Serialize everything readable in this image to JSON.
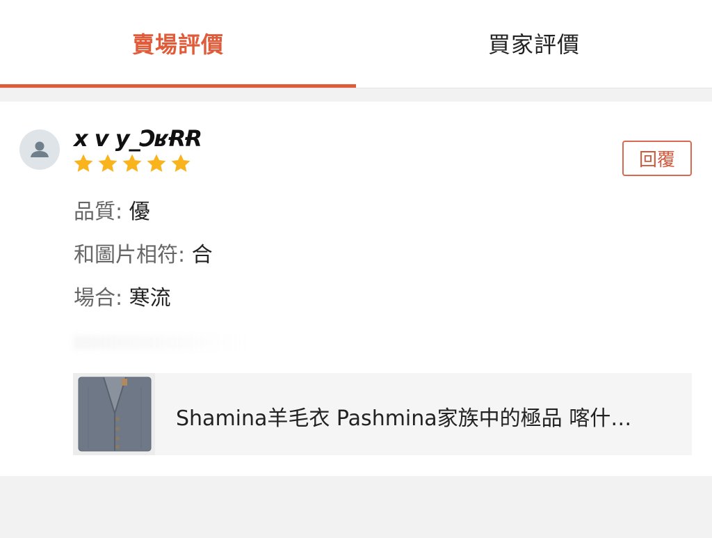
{
  "tabs": [
    {
      "label": "賣場評價",
      "active": true
    },
    {
      "label": "買家評價",
      "active": false
    }
  ],
  "review": {
    "username": "x v y_ƆʁɌɌ",
    "rating": 5,
    "reply_label": "回覆",
    "attributes": [
      {
        "key": "品質: ",
        "value": "優"
      },
      {
        "key": "和圖片相符: ",
        "value": "合"
      },
      {
        "key": "場合: ",
        "value": "寒流"
      }
    ],
    "product": {
      "title": "Shamina羊毛衣 Pashmina家族中的極品 喀什…"
    }
  },
  "colors": {
    "accent": "#e05b3a",
    "star": "#f8b31d",
    "avatar_bg": "#dfe4e8",
    "avatar_fg": "#6f7f8c",
    "product_bg": "#f5f5f5",
    "page_bg": "#f2f2f2"
  },
  "icons": {
    "avatar": "user-silhouette-icon",
    "rating": "star-icon"
  }
}
